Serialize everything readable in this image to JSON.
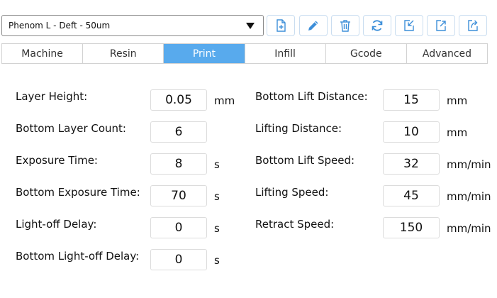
{
  "profile": {
    "selected": "Phenom L - Deft - 50um"
  },
  "toolbar": {
    "buttons": [
      {
        "icon": "add-file-icon"
      },
      {
        "icon": "pencil-icon"
      },
      {
        "icon": "trash-icon"
      },
      {
        "icon": "refresh-icon"
      },
      {
        "icon": "import-icon"
      },
      {
        "icon": "export-icon"
      },
      {
        "icon": "share-icon"
      }
    ],
    "accent_color": "#3d8fd9"
  },
  "tabs": [
    {
      "label": "Machine",
      "active": false
    },
    {
      "label": "Resin",
      "active": false
    },
    {
      "label": "Print",
      "active": true
    },
    {
      "label": "Infill",
      "active": false
    },
    {
      "label": "Gcode",
      "active": false
    },
    {
      "label": "Advanced",
      "active": false
    }
  ],
  "active_tab_color": "#58aaed",
  "left_fields": [
    {
      "label": "Layer Height:",
      "value": "0.05",
      "unit": "mm"
    },
    {
      "label": "Bottom Layer Count:",
      "value": "6",
      "unit": ""
    },
    {
      "label": "Exposure Time:",
      "value": "8",
      "unit": "s"
    },
    {
      "label": "Bottom Exposure Time:",
      "value": "70",
      "unit": "s"
    },
    {
      "label": "Light-off Delay:",
      "value": "0",
      "unit": "s"
    },
    {
      "label": "Bottom Light-off Delay:",
      "value": "0",
      "unit": "s"
    }
  ],
  "right_fields": [
    {
      "label": "Bottom Lift Distance:",
      "value": "15",
      "unit": "mm"
    },
    {
      "label": "Lifting Distance:",
      "value": "10",
      "unit": "mm"
    },
    {
      "label": "Bottom Lift Speed:",
      "value": "32",
      "unit": "mm/min"
    },
    {
      "label": "Lifting Speed:",
      "value": "45",
      "unit": "mm/min"
    },
    {
      "label": "Retract Speed:",
      "value": "150",
      "unit": "mm/min"
    }
  ]
}
